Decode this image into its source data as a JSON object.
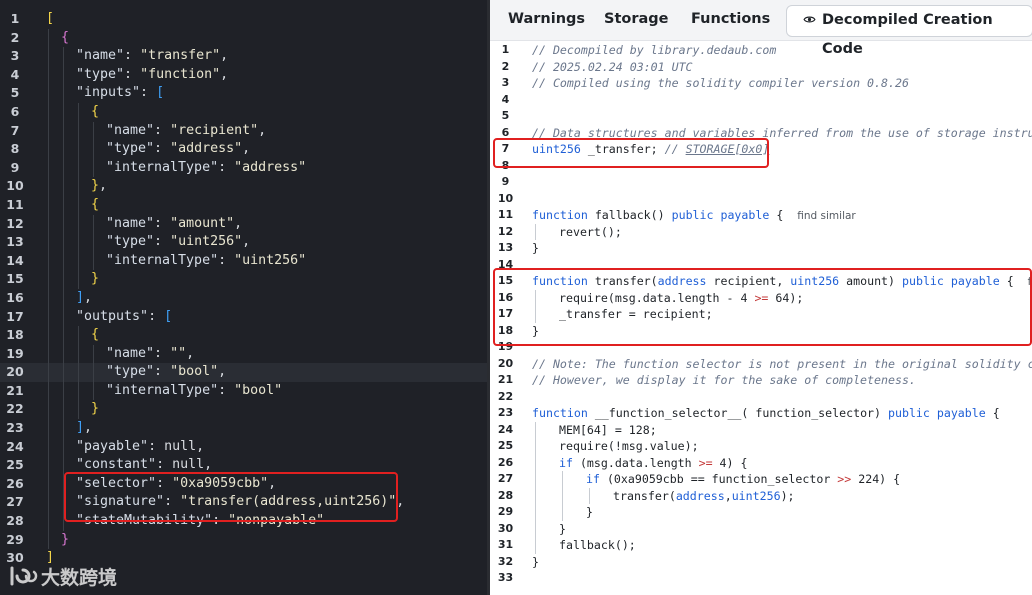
{
  "left_panel": {
    "lines": [
      {
        "n": "1",
        "d": 0,
        "t": [
          [
            "b1",
            "["
          ]
        ]
      },
      {
        "n": "2",
        "d": 1,
        "t": [
          [
            "b2",
            "{"
          ]
        ]
      },
      {
        "n": "3",
        "d": 2,
        "t": [
          [
            "k",
            "\"name\""
          ],
          [
            "p",
            ": "
          ],
          [
            "s",
            "\"transfer\""
          ],
          [
            "p",
            ","
          ]
        ]
      },
      {
        "n": "4",
        "d": 2,
        "t": [
          [
            "k",
            "\"type\""
          ],
          [
            "p",
            ": "
          ],
          [
            "s",
            "\"function\""
          ],
          [
            "p",
            ","
          ]
        ]
      },
      {
        "n": "5",
        "d": 2,
        "t": [
          [
            "k",
            "\"inputs\""
          ],
          [
            "p",
            ": "
          ],
          [
            "b3",
            "["
          ]
        ]
      },
      {
        "n": "6",
        "d": 3,
        "t": [
          [
            "b1",
            "{"
          ]
        ]
      },
      {
        "n": "7",
        "d": 4,
        "t": [
          [
            "k",
            "\"name\""
          ],
          [
            "p",
            ": "
          ],
          [
            "s",
            "\"recipient\""
          ],
          [
            "p",
            ","
          ]
        ]
      },
      {
        "n": "8",
        "d": 4,
        "t": [
          [
            "k",
            "\"type\""
          ],
          [
            "p",
            ": "
          ],
          [
            "s",
            "\"address\""
          ],
          [
            "p",
            ","
          ]
        ]
      },
      {
        "n": "9",
        "d": 4,
        "t": [
          [
            "k",
            "\"internalType\""
          ],
          [
            "p",
            ": "
          ],
          [
            "s",
            "\"address\""
          ]
        ]
      },
      {
        "n": "10",
        "d": 3,
        "t": [
          [
            "b1",
            "}"
          ],
          [
            "p",
            ","
          ]
        ]
      },
      {
        "n": "11",
        "d": 3,
        "t": [
          [
            "b1",
            "{"
          ]
        ]
      },
      {
        "n": "12",
        "d": 4,
        "t": [
          [
            "k",
            "\"name\""
          ],
          [
            "p",
            ": "
          ],
          [
            "s",
            "\"amount\""
          ],
          [
            "p",
            ","
          ]
        ]
      },
      {
        "n": "13",
        "d": 4,
        "t": [
          [
            "k",
            "\"type\""
          ],
          [
            "p",
            ": "
          ],
          [
            "s",
            "\"uint256\""
          ],
          [
            "p",
            ","
          ]
        ]
      },
      {
        "n": "14",
        "d": 4,
        "t": [
          [
            "k",
            "\"internalType\""
          ],
          [
            "p",
            ": "
          ],
          [
            "s",
            "\"uint256\""
          ]
        ]
      },
      {
        "n": "15",
        "d": 3,
        "t": [
          [
            "b1",
            "}"
          ]
        ]
      },
      {
        "n": "16",
        "d": 2,
        "t": [
          [
            "b3",
            "]"
          ],
          [
            "p",
            ","
          ]
        ]
      },
      {
        "n": "17",
        "d": 2,
        "t": [
          [
            "k",
            "\"outputs\""
          ],
          [
            "p",
            ": "
          ],
          [
            "b3",
            "["
          ]
        ]
      },
      {
        "n": "18",
        "d": 3,
        "t": [
          [
            "b1",
            "{"
          ]
        ]
      },
      {
        "n": "19",
        "d": 4,
        "t": [
          [
            "k",
            "\"name\""
          ],
          [
            "p",
            ": "
          ],
          [
            "s",
            "\"\""
          ],
          [
            "p",
            ","
          ]
        ]
      },
      {
        "n": "20",
        "d": 4,
        "t": [
          [
            "k",
            "\"type\""
          ],
          [
            "p",
            ": "
          ],
          [
            "s",
            "\"bool\""
          ],
          [
            "p",
            ","
          ]
        ],
        "hl": true
      },
      {
        "n": "21",
        "d": 4,
        "t": [
          [
            "k",
            "\"internalType\""
          ],
          [
            "p",
            ": "
          ],
          [
            "s",
            "\"bool\""
          ]
        ]
      },
      {
        "n": "22",
        "d": 3,
        "t": [
          [
            "b1",
            "}"
          ]
        ]
      },
      {
        "n": "23",
        "d": 2,
        "t": [
          [
            "b3",
            "]"
          ],
          [
            "p",
            ","
          ]
        ]
      },
      {
        "n": "24",
        "d": 2,
        "t": [
          [
            "k",
            "\"payable\""
          ],
          [
            "p",
            ": null,"
          ]
        ]
      },
      {
        "n": "25",
        "d": 2,
        "t": [
          [
            "k",
            "\"constant\""
          ],
          [
            "p",
            ": null,"
          ]
        ]
      },
      {
        "n": "26",
        "d": 2,
        "t": [
          [
            "k",
            "\"selector\""
          ],
          [
            "p",
            ": "
          ],
          [
            "s",
            "\"0xa9059cbb\""
          ],
          [
            "p",
            ","
          ]
        ]
      },
      {
        "n": "27",
        "d": 2,
        "t": [
          [
            "k",
            "\"signature\""
          ],
          [
            "p",
            ": "
          ],
          [
            "s",
            "\"transfer(address,uint256)\""
          ],
          [
            "p",
            ","
          ]
        ]
      },
      {
        "n": "28",
        "d": 2,
        "t": [
          [
            "k",
            "\"stateMutability\""
          ],
          [
            "p",
            ": "
          ],
          [
            "s",
            "\"nonpayable\""
          ]
        ]
      },
      {
        "n": "29",
        "d": 1,
        "t": [
          [
            "b2",
            "}"
          ]
        ]
      },
      {
        "n": "30",
        "d": 0,
        "t": [
          [
            "b1",
            "]"
          ]
        ]
      }
    ]
  },
  "right_panel": {
    "tabs": {
      "warnings": "Warnings",
      "storage": "Storage",
      "functions": "Functions",
      "decompiled": "Decompiled Creation Code"
    },
    "lines": [
      {
        "n": "1",
        "d": 0,
        "t": [
          [
            "c",
            "// Decompiled by library.dedaub.com"
          ]
        ]
      },
      {
        "n": "2",
        "d": 0,
        "t": [
          [
            "c",
            "// 2025.02.24 03:01 UTC"
          ]
        ]
      },
      {
        "n": "3",
        "d": 0,
        "t": [
          [
            "c",
            "// Compiled using the solidity compiler version 0.8.26"
          ]
        ]
      },
      {
        "n": "4",
        "d": 0,
        "t": []
      },
      {
        "n": "5",
        "d": 0,
        "t": []
      },
      {
        "n": "6",
        "d": 0,
        "t": [
          [
            "c",
            "// Data structures and variables inferred from the use of storage instructions"
          ]
        ]
      },
      {
        "n": "7",
        "d": 0,
        "t": [
          [
            "kw",
            "uint256"
          ],
          [
            "fn",
            " _transfer; "
          ],
          [
            "c",
            "// "
          ],
          [
            "lnk",
            "STORAGE[0x0]"
          ]
        ]
      },
      {
        "n": "8",
        "d": 0,
        "t": []
      },
      {
        "n": "9",
        "d": 0,
        "t": []
      },
      {
        "n": "10",
        "d": 0,
        "t": []
      },
      {
        "n": "11",
        "d": 0,
        "t": [
          [
            "kw",
            "function"
          ],
          [
            "fn",
            " fallback() "
          ],
          [
            "kw",
            "public payable"
          ],
          [
            "fn",
            " {  "
          ],
          [
            "hint",
            "find similar"
          ]
        ]
      },
      {
        "n": "12",
        "d": 1,
        "t": [
          [
            "fn",
            "revert();"
          ]
        ]
      },
      {
        "n": "13",
        "d": 0,
        "t": [
          [
            "fn",
            "}"
          ]
        ]
      },
      {
        "n": "14",
        "d": 0,
        "t": []
      },
      {
        "n": "15",
        "d": 0,
        "t": [
          [
            "kw",
            "function"
          ],
          [
            "fn",
            " transfer("
          ],
          [
            "kw",
            "address"
          ],
          [
            "fn",
            " recipient, "
          ],
          [
            "kw",
            "uint256"
          ],
          [
            "fn",
            " amount) "
          ],
          [
            "kw",
            "public payable"
          ],
          [
            "fn",
            " {  "
          ],
          [
            "hint",
            "find similar"
          ]
        ]
      },
      {
        "n": "16",
        "d": 1,
        "t": [
          [
            "fn",
            "require(msg.data.length - 4 "
          ],
          [
            "op",
            ">="
          ],
          [
            "fn",
            " 64);"
          ]
        ]
      },
      {
        "n": "17",
        "d": 1,
        "t": [
          [
            "fn",
            "_transfer = recipient;"
          ]
        ]
      },
      {
        "n": "18",
        "d": 0,
        "t": [
          [
            "fn",
            "}"
          ]
        ]
      },
      {
        "n": "19",
        "d": 0,
        "t": []
      },
      {
        "n": "20",
        "d": 0,
        "t": [
          [
            "c",
            "// Note: The function selector is not present in the original solidity code."
          ]
        ]
      },
      {
        "n": "21",
        "d": 0,
        "t": [
          [
            "c",
            "// However, we display it for the sake of completeness."
          ]
        ]
      },
      {
        "n": "22",
        "d": 0,
        "t": []
      },
      {
        "n": "23",
        "d": 0,
        "t": [
          [
            "kw",
            "function"
          ],
          [
            "fn",
            " __function_selector__( function_selector) "
          ],
          [
            "kw",
            "public payable"
          ],
          [
            "fn",
            " {"
          ]
        ]
      },
      {
        "n": "24",
        "d": 1,
        "t": [
          [
            "fn",
            "MEM[64] = 128;"
          ]
        ]
      },
      {
        "n": "25",
        "d": 1,
        "t": [
          [
            "fn",
            "require(!msg.value);"
          ]
        ]
      },
      {
        "n": "26",
        "d": 1,
        "t": [
          [
            "kw",
            "if"
          ],
          [
            "fn",
            " (msg.data.length "
          ],
          [
            "op",
            ">="
          ],
          [
            "fn",
            " 4) {"
          ]
        ]
      },
      {
        "n": "27",
        "d": 2,
        "t": [
          [
            "kw",
            "if"
          ],
          [
            "fn",
            " (0xa9059cbb == function_selector "
          ],
          [
            "op",
            ">>"
          ],
          [
            "fn",
            " 224) {"
          ]
        ]
      },
      {
        "n": "28",
        "d": 3,
        "t": [
          [
            "fn",
            "transfer("
          ],
          [
            "kw",
            "address"
          ],
          [
            "fn",
            ","
          ],
          [
            "kw",
            "uint256"
          ],
          [
            "fn",
            ");"
          ]
        ]
      },
      {
        "n": "29",
        "d": 2,
        "t": [
          [
            "fn",
            "}"
          ]
        ]
      },
      {
        "n": "30",
        "d": 1,
        "t": [
          [
            "fn",
            "}"
          ]
        ]
      },
      {
        "n": "31",
        "d": 1,
        "t": [
          [
            "fn",
            "fallback();"
          ]
        ]
      },
      {
        "n": "32",
        "d": 0,
        "t": [
          [
            "fn",
            "}"
          ]
        ]
      },
      {
        "n": "33",
        "d": 0,
        "t": []
      }
    ]
  },
  "watermark": {
    "text": "大数跨境"
  },
  "colors": {
    "highlight_box": "#e02020",
    "keyword": "#1f5fd6",
    "comment": "#6b778c",
    "dark_bg": "#1f2127"
  },
  "icons": {
    "decompiled_tab": "eye-icon",
    "watermark": "brand-logo-icon"
  }
}
